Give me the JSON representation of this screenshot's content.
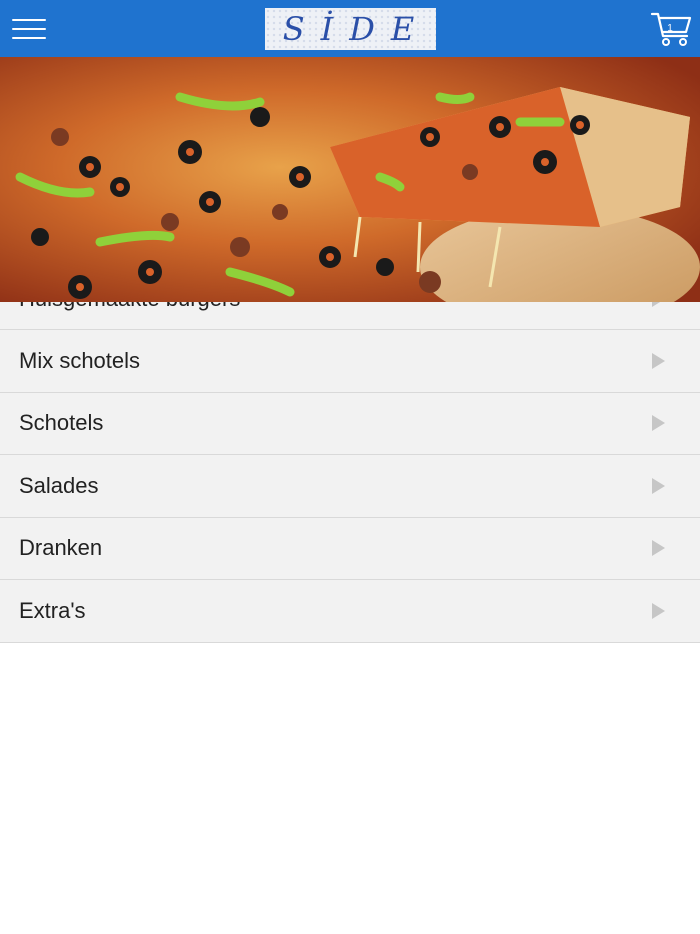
{
  "header": {
    "menu_icon": "hamburger-icon",
    "logo_text": "SİDE",
    "cart_icon": "shopping-cart-icon",
    "cart_count": "1",
    "background_color": "#1f73cf"
  },
  "hero": {
    "image": "pizza-banner"
  },
  "menu": {
    "items": [
      {
        "label": "Huisgemaakte burgers"
      },
      {
        "label": "Mix schotels"
      },
      {
        "label": "Schotels"
      },
      {
        "label": "Salades"
      },
      {
        "label": "Dranken"
      },
      {
        "label": "Extra's"
      }
    ],
    "arrow_icon": "triangle-right-icon",
    "item_background": "#f2f2f2"
  }
}
